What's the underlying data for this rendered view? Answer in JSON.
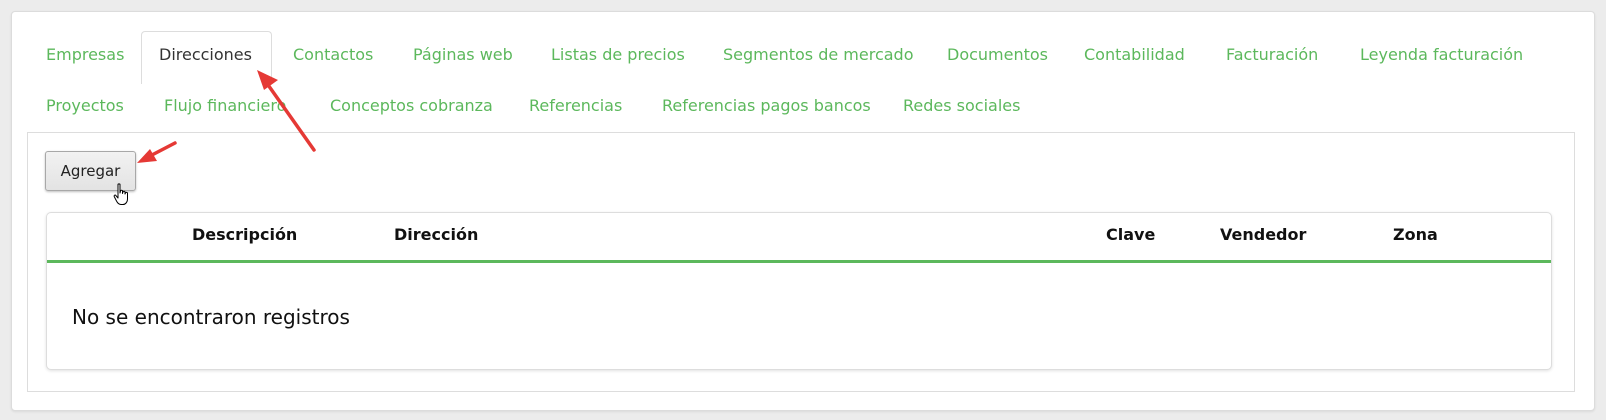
{
  "tabs": {
    "row1": [
      "Empresas",
      "Direcciones",
      "Contactos",
      "Páginas web",
      "Listas de precios",
      "Segmentos de mercado",
      "Documentos",
      "Contabilidad",
      "Facturación",
      "Leyenda facturación"
    ],
    "row2": [
      "Proyectos",
      "Flujo financiero",
      "Conceptos cobranza",
      "Referencias",
      "Referencias pagos bancos",
      "Redes sociales"
    ],
    "active": "Direcciones"
  },
  "toolbar": {
    "add_label": "Agregar"
  },
  "table": {
    "columns": [
      "Descripción",
      "Dirección",
      "Clave",
      "Vendedor",
      "Zona"
    ],
    "empty_message": "No se encontraron registros"
  },
  "colors": {
    "accent_green": "#5cb85c",
    "annotation_arrow": "#e53935"
  },
  "annotations": {
    "arrows": [
      "arrow-pointing-to-direcciones-tab",
      "arrow-pointing-to-agregar-button"
    ]
  }
}
